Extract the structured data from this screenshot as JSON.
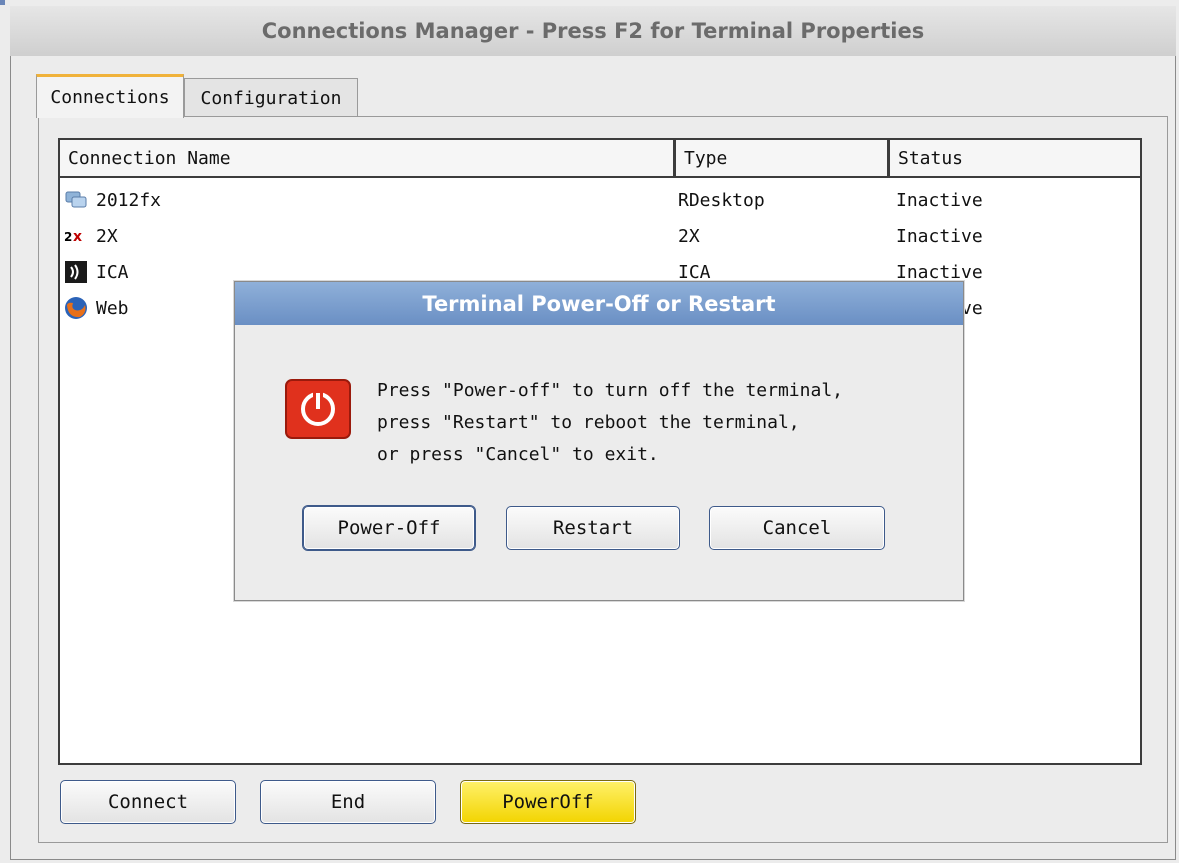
{
  "window": {
    "title": "Connections Manager - Press F2 for Terminal Properties"
  },
  "tabs": [
    {
      "label": "Connections",
      "active": true
    },
    {
      "label": "Configuration",
      "active": false
    }
  ],
  "table": {
    "columns": [
      "Connection Name",
      "Type",
      "Status"
    ],
    "rows": [
      {
        "name": "2012fx",
        "icon": "rdesktop-icon",
        "type": "RDesktop",
        "status": "Inactive"
      },
      {
        "name": "2X",
        "icon": "2x-icon",
        "type": "2X",
        "status": "Inactive"
      },
      {
        "name": "ICA",
        "icon": "ica-icon",
        "type": "ICA",
        "status": "Inactive"
      },
      {
        "name": "Web",
        "icon": "firefox-icon",
        "type": "",
        "status": "Inactive"
      }
    ]
  },
  "buttons": {
    "connect": "Connect",
    "end": "End",
    "poweroff": "PowerOff"
  },
  "dialog": {
    "title": "Terminal Power-Off or Restart",
    "icon": "power-icon",
    "message": [
      "Press \"Power-off\" to turn off the terminal,",
      "press \"Restart\" to reboot the terminal,",
      "or press \"Cancel\" to exit."
    ],
    "buttons": {
      "poweroff": "Power-Off",
      "restart": "Restart",
      "cancel": "Cancel"
    }
  },
  "colors": {
    "poweroff_button": "#f2d400",
    "dialog_title": "#7a9ccd",
    "active_tab_accent": "#f0b23a"
  }
}
